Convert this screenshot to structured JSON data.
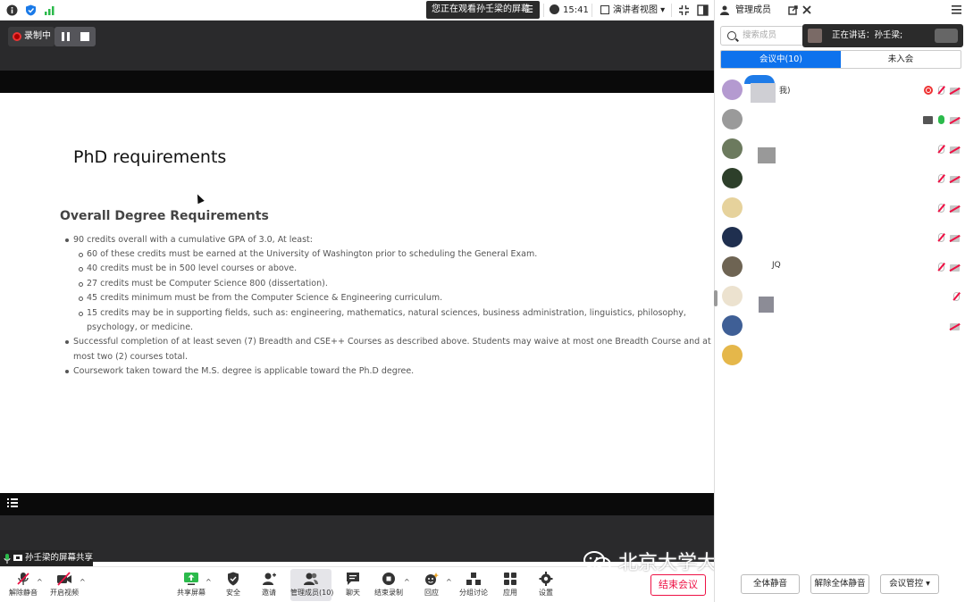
{
  "topbar": {
    "watching": "您正在观看孙壬梁的屏幕",
    "time": "15:41",
    "view_mode": "演讲者视图",
    "panel_title": "管理成员"
  },
  "recording": {
    "label": "录制中"
  },
  "slide": {
    "title": "PhD requirements",
    "heading": "Overall Degree Requirements",
    "bullets": [
      "90 credits overall with a cumulative GPA of 3.0, At least:",
      "60 of these credits must be earned at the University of Washington prior to scheduling the General Exam.",
      "40 credits must be in 500 level courses or above.",
      "27 credits must be Computer Science 800 (dissertation).",
      "45 credits minimum must be from the Computer Science & Engineering curriculum.",
      "15 credits may be in supporting fields, such as: engineering, mathematics, natural sciences, business administration, linguistics, philosophy,",
      "psychology, or medicine.",
      "Successful completion of at least seven (7) Breadth and CSE++ Courses as described above. Students may waive at most one Breadth Course and at",
      "most two (2) courses total.",
      "Coursework taken toward the M.S. degree is applicable toward the Ph.D degree."
    ]
  },
  "share_label": "孙壬梁的屏幕共享",
  "toolbar": {
    "unmute": "解除静音",
    "video": "开启视频",
    "share": "共享屏幕",
    "security": "安全",
    "invite": "邀请",
    "participants": "管理成员(10)",
    "chat": "聊天",
    "end_record": "结束录制",
    "reactions": "回应",
    "breakout": "分组讨论",
    "apps": "应用",
    "settings": "设置",
    "end_meeting": "结束会议"
  },
  "watermark": "北京大学大数据科学研究中心",
  "panel": {
    "search_placeholder": "搜索成员",
    "speaking": "正在讲话：孙壬梁;",
    "tab_in": "会议中(10)",
    "tab_out": "未入会",
    "participants": [
      {
        "name": "我)",
        "color": "#b49ad0"
      },
      {
        "name": "",
        "color": "#9a9a9a"
      },
      {
        "name": "",
        "color": "#6c7a5e"
      },
      {
        "name": "",
        "color": "#2d3f2a"
      },
      {
        "name": "",
        "color": "#e6d29c"
      },
      {
        "name": "",
        "color": "#1f2f4f"
      },
      {
        "name": "JQ",
        "color": "#6e6453"
      },
      {
        "name": "",
        "color": "#ece2cf"
      },
      {
        "name": "",
        "color": "#3f5f96"
      },
      {
        "name": "",
        "color": "#e5b74a"
      }
    ],
    "mute_all": "全体静音",
    "unmute_all": "解除全体静音",
    "control": "会议管控"
  }
}
